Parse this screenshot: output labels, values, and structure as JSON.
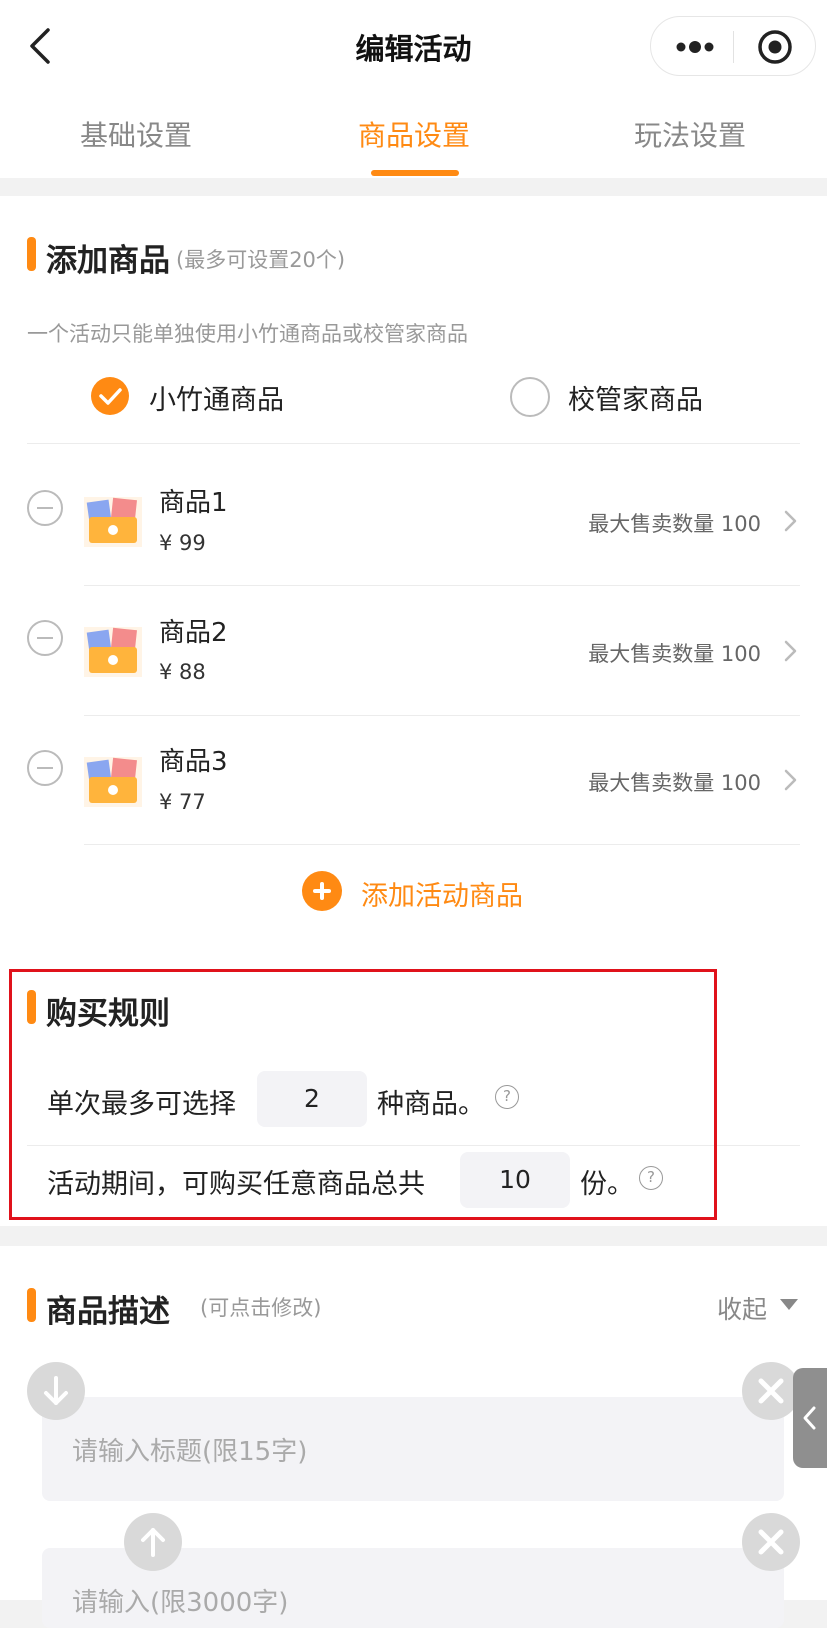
{
  "nav": {
    "title": "编辑活动",
    "back_icon": "chevron-left-icon",
    "more_icon": "more-dots-icon",
    "close_icon": "target-circle-icon"
  },
  "tabs": [
    {
      "label": "基础设置",
      "active": false
    },
    {
      "label": "商品设置",
      "active": true
    },
    {
      "label": "玩法设置",
      "active": false
    }
  ],
  "accent_color": "#ff8a13",
  "add_products": {
    "title": "添加商品",
    "subtitle": "(最多可设置20个)",
    "hint": "一个活动只能单独使用小竹通商品或校管家商品",
    "source_options": [
      {
        "label": "小竹通商品",
        "checked": true
      },
      {
        "label": "校管家商品",
        "checked": false
      }
    ],
    "products": [
      {
        "name": "商品1",
        "price": "¥ 99",
        "max_label": "最大售卖数量 100"
      },
      {
        "name": "商品2",
        "price": "¥ 88",
        "max_label": "最大售卖数量 100"
      },
      {
        "name": "商品3",
        "price": "¥ 77",
        "max_label": "最大售卖数量 100"
      }
    ],
    "add_button": "添加活动商品"
  },
  "purchase_rules": {
    "title": "购买规则",
    "rule1_prefix": "单次最多可选择",
    "rule1_value": "2",
    "rule1_suffix": "种商品。",
    "rule2_prefix": "活动期间，可购买任意商品总共",
    "rule2_value": "10",
    "rule2_suffix": "份。",
    "help_glyph": "?"
  },
  "description": {
    "title": "商品描述",
    "subtitle": "(可点击修改)",
    "collapse_label": "收起",
    "title_placeholder": "请输入标题(限15字)",
    "content_placeholder": "请输入(限3000字)"
  }
}
